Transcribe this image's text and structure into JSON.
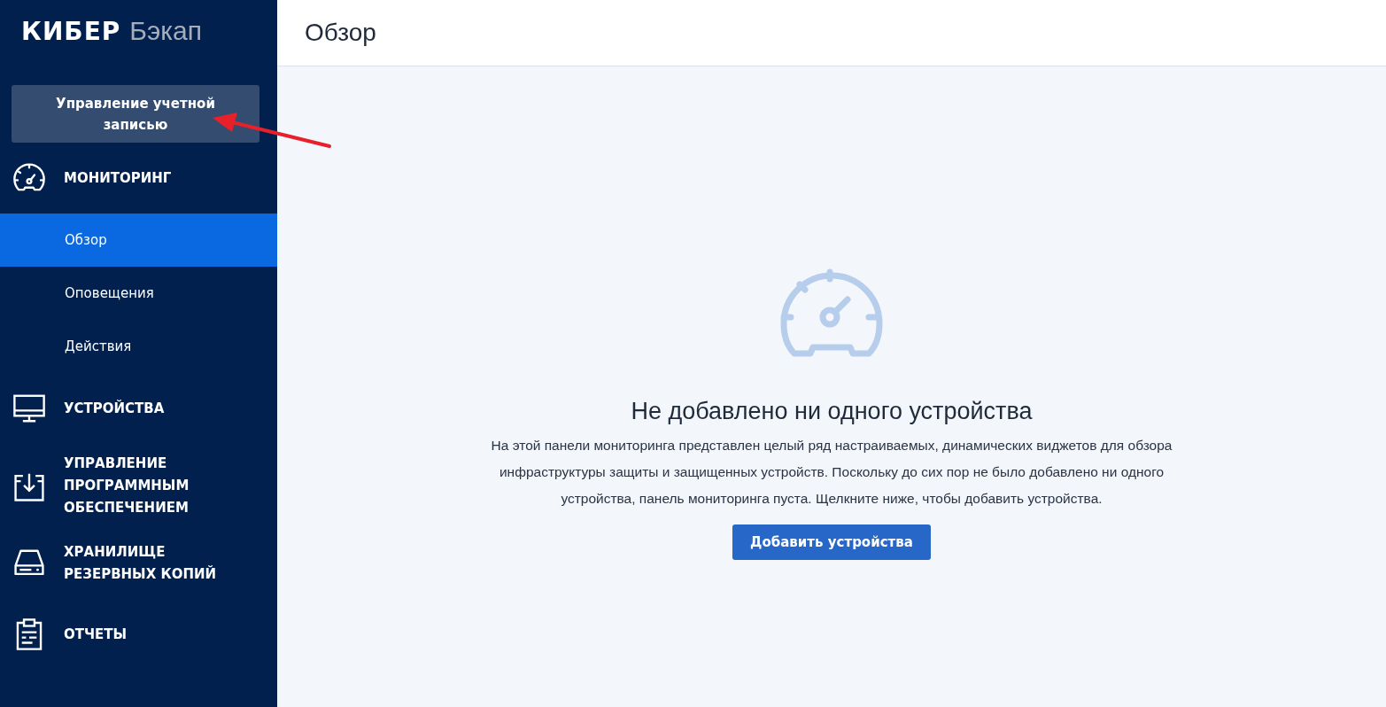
{
  "logo": {
    "brand": "КИБЕР",
    "product": "Бэкап"
  },
  "account_button": "Управление учетной записью",
  "nav": [
    {
      "label": "МОНИТОРИНГ",
      "children": [
        {
          "label": "Обзор",
          "selected": true
        },
        {
          "label": "Оповещения",
          "selected": false
        },
        {
          "label": "Действия",
          "selected": false
        }
      ]
    },
    {
      "label": "УСТРОЙСТВА"
    },
    {
      "label": "УПРАВЛЕНИЕ ПРОГРАММНЫМ ОБЕСПЕЧЕНИЕМ"
    },
    {
      "label": "ХРАНИЛИЩЕ РЕЗЕРВНЫХ КОПИЙ"
    },
    {
      "label": "ОТЧЕТЫ"
    }
  ],
  "page_title": "Обзор",
  "empty_state": {
    "title": "Не добавлено ни одного устройства",
    "description": "На этой панели мониторинга представлен целый ряд настраиваемых, динамических виджетов для обзора инфраструктуры защиты и защищенных устройств. Поскольку до сих пор не было добавлено ни одного устройства, панель мониторинга пуста. Щелкните ниже, чтобы добавить устройства.",
    "button": "Добавить устройства"
  }
}
